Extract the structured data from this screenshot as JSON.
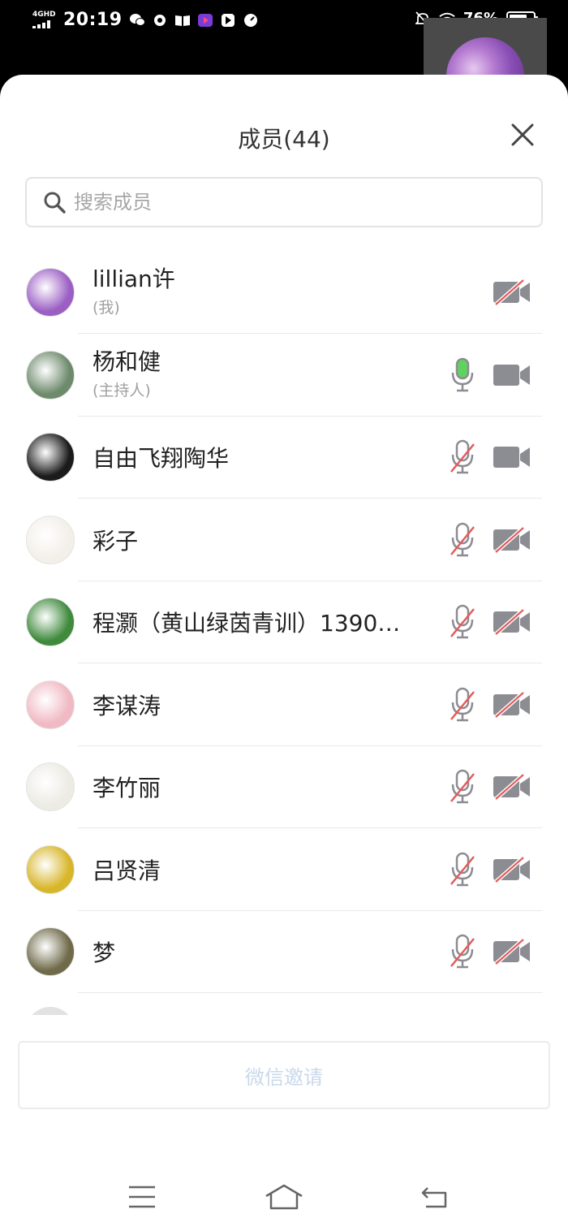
{
  "status_bar": {
    "network": "4GHD",
    "time": "20:19",
    "battery_percent": "76%",
    "battery_level": 0.76,
    "icons": [
      "wechat-icon",
      "settings-badge-icon",
      "book-icon",
      "video-app-icon",
      "dark-app-icon",
      "gauge-icon",
      "bell-muted-icon",
      "wifi-icon"
    ]
  },
  "sheet": {
    "title": "成员(44)",
    "close_icon": "close-icon",
    "search": {
      "placeholder": "搜索成员",
      "value": ""
    },
    "invite_label": "微信邀请"
  },
  "members": [
    {
      "name": "lillian许",
      "sub": "(我)",
      "mic": "hidden",
      "camera": "off",
      "avatar_color": "#9b5fc4"
    },
    {
      "name": "杨和健",
      "sub": "(主持人)",
      "mic": "on",
      "camera": "on",
      "avatar_color": "#6d8a6b"
    },
    {
      "name": "自由飞翔陶华",
      "sub": "",
      "mic": "off",
      "camera": "on",
      "avatar_color": "#1b1b1b"
    },
    {
      "name": "彩子",
      "sub": "",
      "mic": "off",
      "camera": "off",
      "avatar_color": "#f3efe9"
    },
    {
      "name": "程灏（黄山绿茵青训）1390…",
      "sub": "",
      "mic": "off",
      "camera": "off",
      "avatar_color": "#3f8a3d"
    },
    {
      "name": "李谋涛",
      "sub": "",
      "mic": "off",
      "camera": "off",
      "avatar_color": "#f0b9c3"
    },
    {
      "name": "李竹丽",
      "sub": "",
      "mic": "off",
      "camera": "off",
      "avatar_color": "#ecebe4"
    },
    {
      "name": "吕贤清",
      "sub": "",
      "mic": "off",
      "camera": "off",
      "avatar_color": "#d8b62a"
    },
    {
      "name": "梦",
      "sub": "",
      "mic": "off",
      "camera": "off",
      "avatar_color": "#6f6a4a"
    }
  ],
  "colors": {
    "mic_on": "#5fd35f",
    "icon_gray": "#8c8c93",
    "strike_red": "#e35b5b",
    "invite_text": "#c9d8ea"
  },
  "nav": [
    "menu-icon",
    "home-icon",
    "back-icon"
  ]
}
